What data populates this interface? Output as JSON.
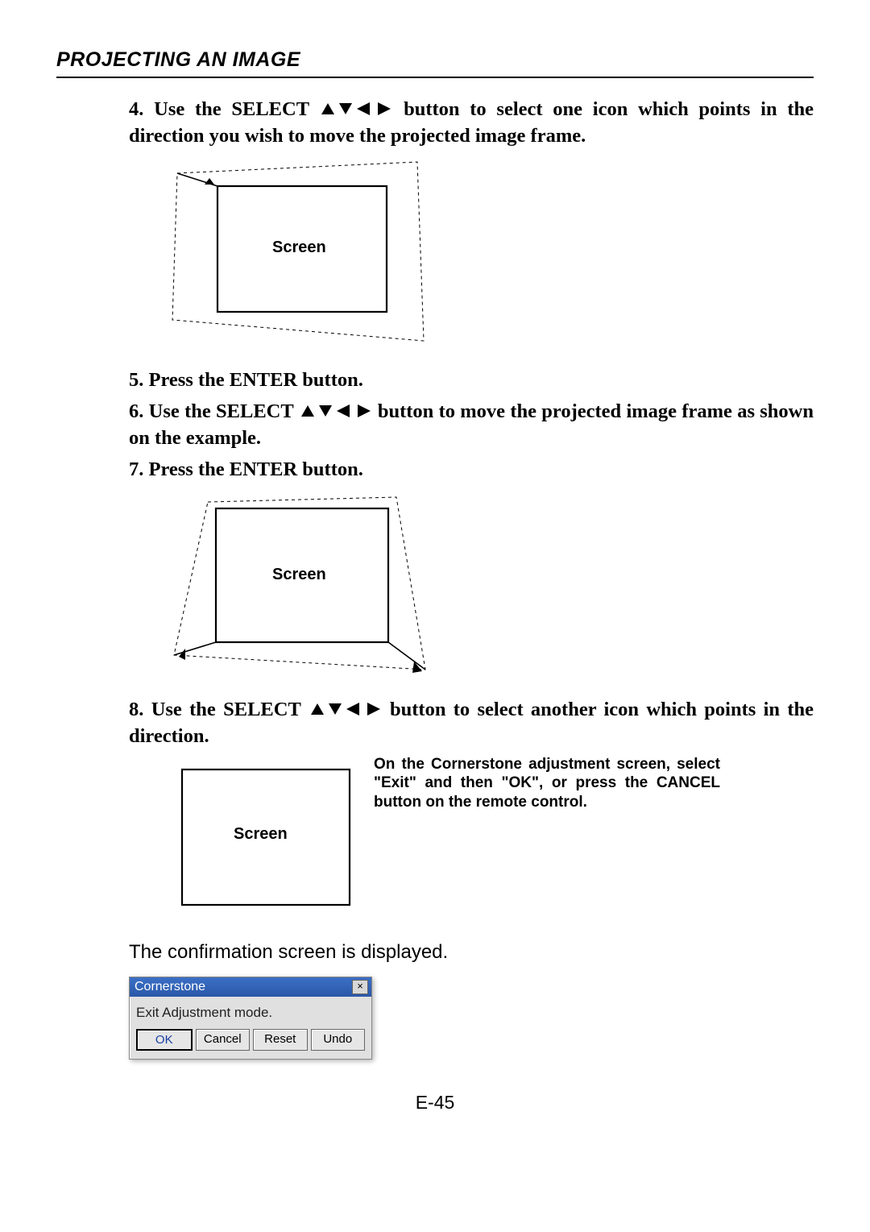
{
  "header": {
    "title": "PROJECTING AN IMAGE"
  },
  "arrows_glyph": "▲▼◀▶",
  "steps": {
    "s4_num": "4.",
    "s4_pre": "Use the SELECT ",
    "s4_post": " button to select one icon which points in the direction you wish to move the projected image frame.",
    "s5_num": "5.",
    "s5": "Press the ENTER button.",
    "s6_num": "6.",
    "s6_pre": "Use the SELECT ",
    "s6_post": " button to move the projected image frame as shown on the example.",
    "s7_num": "7.",
    "s7": "Press the ENTER button.",
    "s8_num": "8.",
    "s8_pre": "Use the SELECT ",
    "s8_post": " button to select another icon which points in the direction."
  },
  "figures": {
    "screen_label": "Screen"
  },
  "side_note": "On the Cornerstone adjustment screen, select \"Exit\" and then \"OK\", or press the CANCEL button on the remote control.",
  "confirm_text": "The confirmation screen is displayed.",
  "dialog": {
    "title": "Cornerstone",
    "body": "Exit Adjustment mode.",
    "close_glyph": "×",
    "buttons": {
      "ok": "OK",
      "cancel": "Cancel",
      "reset": "Reset",
      "undo": "Undo"
    }
  },
  "page_number": "E-45"
}
